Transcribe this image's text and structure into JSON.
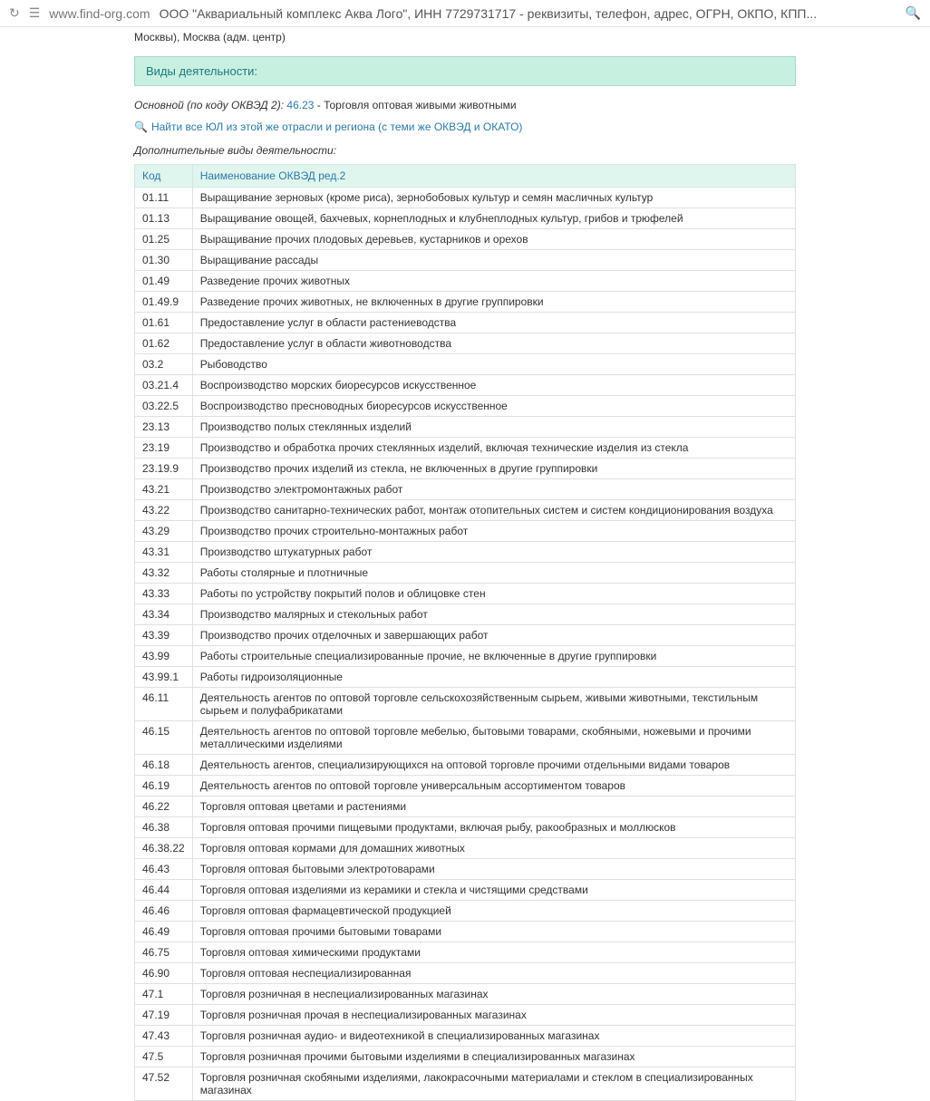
{
  "browser": {
    "url": "www.find-org.com",
    "title": "ООО \"Аквариальный комплекс Аква Лого\", ИНН 7729731717 - реквизиты, телефон, адрес, ОГРН, ОКПО, КПП..."
  },
  "top_continuation": "Москвы), Москва (адм. центр)",
  "section_header": "Виды деятельности:",
  "main_activity": {
    "prefix": "Основной (по коду ОКВЭД 2):",
    "code": "46.23",
    "desc": "- Торговля оптовая живыми животными"
  },
  "find_link": "Найти все ЮЛ из этой же отрасли и региона (с теми же ОКВЭД и ОКАТО)",
  "additional_label": "Дополнительные виды деятельности:",
  "table_headers": {
    "code": "Код",
    "name": "Наименование ОКВЭД ред.2"
  },
  "activities": [
    {
      "code": "01.11",
      "name": "Выращивание зерновых (кроме риса), зернобобовых культур и семян масличных культур"
    },
    {
      "code": "01.13",
      "name": "Выращивание овощей, бахчевых, корнеплодных и клубнеплодных культур, грибов и трюфелей"
    },
    {
      "code": "01.25",
      "name": "Выращивание прочих плодовых деревьев, кустарников и орехов"
    },
    {
      "code": "01.30",
      "name": "Выращивание рассады"
    },
    {
      "code": "01.49",
      "name": "Разведение прочих животных"
    },
    {
      "code": "01.49.9",
      "name": "Разведение прочих животных, не включенных в другие группировки"
    },
    {
      "code": "01.61",
      "name": "Предоставление услуг в области растениеводства"
    },
    {
      "code": "01.62",
      "name": "Предоставление услуг в области животноводства"
    },
    {
      "code": "03.2",
      "name": "Рыбоводство"
    },
    {
      "code": "03.21.4",
      "name": "Воспроизводство морских биоресурсов искусственное"
    },
    {
      "code": "03.22.5",
      "name": "Воспроизводство пресноводных биоресурсов искусственное"
    },
    {
      "code": "23.13",
      "name": "Производство полых стеклянных изделий"
    },
    {
      "code": "23.19",
      "name": "Производство и обработка прочих стеклянных изделий, включая технические изделия из стекла"
    },
    {
      "code": "23.19.9",
      "name": "Производство прочих изделий из стекла, не включенных в другие группировки"
    },
    {
      "code": "43.21",
      "name": "Производство электромонтажных работ"
    },
    {
      "code": "43.22",
      "name": "Производство санитарно-технических работ, монтаж отопительных систем и систем кондиционирования воздуха"
    },
    {
      "code": "43.29",
      "name": "Производство прочих строительно-монтажных работ"
    },
    {
      "code": "43.31",
      "name": "Производство штукатурных работ"
    },
    {
      "code": "43.32",
      "name": "Работы столярные и плотничные"
    },
    {
      "code": "43.33",
      "name": "Работы по устройству покрытий полов и облицовке стен"
    },
    {
      "code": "43.34",
      "name": "Производство малярных и стекольных работ"
    },
    {
      "code": "43.39",
      "name": "Производство прочих отделочных и завершающих работ"
    },
    {
      "code": "43.99",
      "name": "Работы строительные специализированные прочие, не включенные в другие группировки"
    },
    {
      "code": "43.99.1",
      "name": "Работы гидроизоляционные"
    },
    {
      "code": "46.11",
      "name": "Деятельность агентов по оптовой торговле сельскохозяйственным сырьем, живыми животными, текстильным сырьем и полуфабрикатами"
    },
    {
      "code": "46.15",
      "name": "Деятельность агентов по оптовой торговле мебелью, бытовыми товарами, скобяными, ножевыми и прочими металлическими изделиями"
    },
    {
      "code": "46.18",
      "name": "Деятельность агентов, специализирующихся на оптовой торговле прочими отдельными видами товаров"
    },
    {
      "code": "46.19",
      "name": "Деятельность агентов по оптовой торговле универсальным ассортиментом товаров"
    },
    {
      "code": "46.22",
      "name": "Торговля оптовая цветами и растениями"
    },
    {
      "code": "46.38",
      "name": "Торговля оптовая прочими пищевыми продуктами, включая рыбу, ракообразных и моллюсков"
    },
    {
      "code": "46.38.22",
      "name": "Торговля оптовая кормами для домашних животных"
    },
    {
      "code": "46.43",
      "name": "Торговля оптовая бытовыми электротоварами"
    },
    {
      "code": "46.44",
      "name": "Торговля оптовая изделиями из керамики и стекла и чистящими средствами"
    },
    {
      "code": "46.46",
      "name": "Торговля оптовая фармацевтической продукцией"
    },
    {
      "code": "46.49",
      "name": "Торговля оптовая прочими бытовыми товарами"
    },
    {
      "code": "46.75",
      "name": "Торговля оптовая химическими продуктами"
    },
    {
      "code": "46.90",
      "name": "Торговля оптовая неспециализированная"
    },
    {
      "code": "47.1",
      "name": "Торговля розничная в неспециализированных магазинах"
    },
    {
      "code": "47.19",
      "name": "Торговля розничная прочая в неспециализированных магазинах"
    },
    {
      "code": "47.43",
      "name": "Торговля розничная аудио- и видеотехникой в специализированных магазинах"
    },
    {
      "code": "47.5",
      "name": "Торговля розничная прочими бытовыми изделиями в специализированных магазинах"
    },
    {
      "code": "47.52",
      "name": "Торговля розничная скобяными изделиями, лакокрасочными материалами и стеклом в специализированных магазинах"
    }
  ]
}
